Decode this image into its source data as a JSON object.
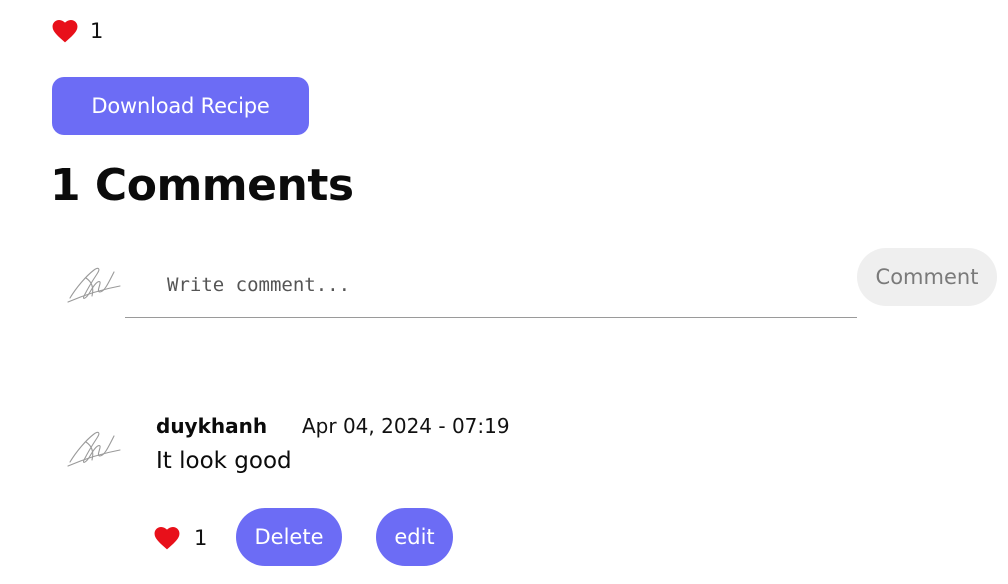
{
  "recipe": {
    "like_count": "1",
    "download_label": "Download Recipe"
  },
  "comments_section": {
    "title": "1 Comments",
    "input_placeholder": "Write comment...",
    "submit_label": "Comment"
  },
  "comments": [
    {
      "author": "duykhanh",
      "date": "Apr 04, 2024 - 07:19",
      "body": "It look good",
      "like_count": "1",
      "delete_label": "Delete",
      "edit_label": "edit"
    }
  ],
  "colors": {
    "accent": "#6c6cf5",
    "heart": "#e8101a",
    "comment_button_bg": "#efefef"
  },
  "icons": {
    "like": "heart-icon",
    "avatar": "signature-avatar"
  }
}
